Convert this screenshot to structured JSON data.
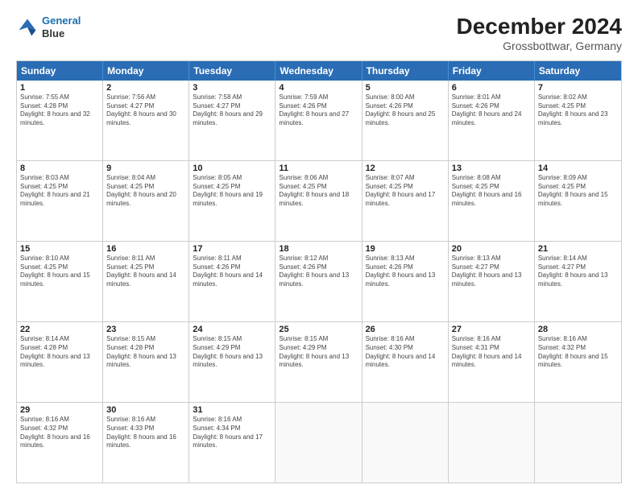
{
  "header": {
    "logo_line1": "General",
    "logo_line2": "Blue",
    "main_title": "December 2024",
    "subtitle": "Grossbottwar, Germany"
  },
  "calendar": {
    "days_of_week": [
      "Sunday",
      "Monday",
      "Tuesday",
      "Wednesday",
      "Thursday",
      "Friday",
      "Saturday"
    ],
    "weeks": [
      [
        {
          "day": "1",
          "sunrise": "7:55 AM",
          "sunset": "4:28 PM",
          "daylight": "8 hours and 32 minutes."
        },
        {
          "day": "2",
          "sunrise": "7:56 AM",
          "sunset": "4:27 PM",
          "daylight": "8 hours and 30 minutes."
        },
        {
          "day": "3",
          "sunrise": "7:58 AM",
          "sunset": "4:27 PM",
          "daylight": "8 hours and 29 minutes."
        },
        {
          "day": "4",
          "sunrise": "7:59 AM",
          "sunset": "4:26 PM",
          "daylight": "8 hours and 27 minutes."
        },
        {
          "day": "5",
          "sunrise": "8:00 AM",
          "sunset": "4:26 PM",
          "daylight": "8 hours and 25 minutes."
        },
        {
          "day": "6",
          "sunrise": "8:01 AM",
          "sunset": "4:26 PM",
          "daylight": "8 hours and 24 minutes."
        },
        {
          "day": "7",
          "sunrise": "8:02 AM",
          "sunset": "4:25 PM",
          "daylight": "8 hours and 23 minutes."
        }
      ],
      [
        {
          "day": "8",
          "sunrise": "8:03 AM",
          "sunset": "4:25 PM",
          "daylight": "8 hours and 21 minutes."
        },
        {
          "day": "9",
          "sunrise": "8:04 AM",
          "sunset": "4:25 PM",
          "daylight": "8 hours and 20 minutes."
        },
        {
          "day": "10",
          "sunrise": "8:05 AM",
          "sunset": "4:25 PM",
          "daylight": "8 hours and 19 minutes."
        },
        {
          "day": "11",
          "sunrise": "8:06 AM",
          "sunset": "4:25 PM",
          "daylight": "8 hours and 18 minutes."
        },
        {
          "day": "12",
          "sunrise": "8:07 AM",
          "sunset": "4:25 PM",
          "daylight": "8 hours and 17 minutes."
        },
        {
          "day": "13",
          "sunrise": "8:08 AM",
          "sunset": "4:25 PM",
          "daylight": "8 hours and 16 minutes."
        },
        {
          "day": "14",
          "sunrise": "8:09 AM",
          "sunset": "4:25 PM",
          "daylight": "8 hours and 15 minutes."
        }
      ],
      [
        {
          "day": "15",
          "sunrise": "8:10 AM",
          "sunset": "4:25 PM",
          "daylight": "8 hours and 15 minutes."
        },
        {
          "day": "16",
          "sunrise": "8:11 AM",
          "sunset": "4:25 PM",
          "daylight": "8 hours and 14 minutes."
        },
        {
          "day": "17",
          "sunrise": "8:11 AM",
          "sunset": "4:26 PM",
          "daylight": "8 hours and 14 minutes."
        },
        {
          "day": "18",
          "sunrise": "8:12 AM",
          "sunset": "4:26 PM",
          "daylight": "8 hours and 13 minutes."
        },
        {
          "day": "19",
          "sunrise": "8:13 AM",
          "sunset": "4:26 PM",
          "daylight": "8 hours and 13 minutes."
        },
        {
          "day": "20",
          "sunrise": "8:13 AM",
          "sunset": "4:27 PM",
          "daylight": "8 hours and 13 minutes."
        },
        {
          "day": "21",
          "sunrise": "8:14 AM",
          "sunset": "4:27 PM",
          "daylight": "8 hours and 13 minutes."
        }
      ],
      [
        {
          "day": "22",
          "sunrise": "8:14 AM",
          "sunset": "4:28 PM",
          "daylight": "8 hours and 13 minutes."
        },
        {
          "day": "23",
          "sunrise": "8:15 AM",
          "sunset": "4:28 PM",
          "daylight": "8 hours and 13 minutes."
        },
        {
          "day": "24",
          "sunrise": "8:15 AM",
          "sunset": "4:29 PM",
          "daylight": "8 hours and 13 minutes."
        },
        {
          "day": "25",
          "sunrise": "8:15 AM",
          "sunset": "4:29 PM",
          "daylight": "8 hours and 13 minutes."
        },
        {
          "day": "26",
          "sunrise": "8:16 AM",
          "sunset": "4:30 PM",
          "daylight": "8 hours and 14 minutes."
        },
        {
          "day": "27",
          "sunrise": "8:16 AM",
          "sunset": "4:31 PM",
          "daylight": "8 hours and 14 minutes."
        },
        {
          "day": "28",
          "sunrise": "8:16 AM",
          "sunset": "4:32 PM",
          "daylight": "8 hours and 15 minutes."
        }
      ],
      [
        {
          "day": "29",
          "sunrise": "8:16 AM",
          "sunset": "4:32 PM",
          "daylight": "8 hours and 16 minutes."
        },
        {
          "day": "30",
          "sunrise": "8:16 AM",
          "sunset": "4:33 PM",
          "daylight": "8 hours and 16 minutes."
        },
        {
          "day": "31",
          "sunrise": "8:16 AM",
          "sunset": "4:34 PM",
          "daylight": "8 hours and 17 minutes."
        },
        null,
        null,
        null,
        null
      ]
    ]
  }
}
